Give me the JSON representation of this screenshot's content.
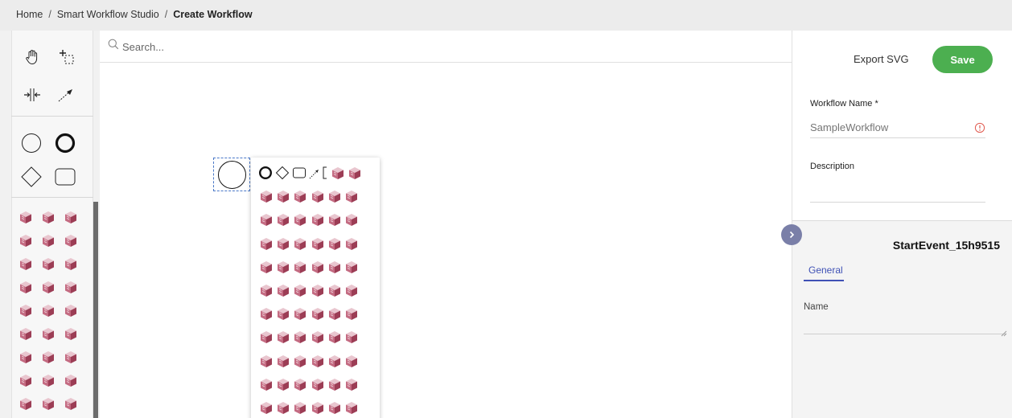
{
  "breadcrumb": {
    "items": [
      "Home",
      "Smart Workflow Studio"
    ],
    "separator": "/",
    "current": "Create Workflow"
  },
  "palette": {
    "tools": [
      "hand-tool-icon",
      "lasso-tool-icon",
      "space-tool-icon",
      "global-connect-icon"
    ],
    "shapes": [
      "start-event-icon",
      "end-event-icon",
      "gateway-icon",
      "task-icon"
    ],
    "custom_task_icon": "cube-task-icon"
  },
  "canvas": {
    "search": {
      "placeholder": "Search...",
      "value": ""
    },
    "selected_element": "start-event"
  },
  "context_pad": {
    "items": [
      "end-event-icon",
      "gateway-icon",
      "task-icon",
      "connect-icon",
      "annotation-icon",
      "cube-task-icon"
    ]
  },
  "panel": {
    "export_label": "Export SVG",
    "save_label": "Save",
    "workflow_name_label": "Workflow Name *",
    "workflow_name_placeholder": "SampleWorkflow",
    "description_label": "Description",
    "element_title": "StartEvent_15h9515",
    "tab_general": "General",
    "name_label": "Name"
  },
  "colors": {
    "save": "#4caf50",
    "accent": "#3f51b5",
    "cube_top": "#e9c6cf",
    "cube_left": "#c46b82",
    "cube_right": "#9c3d55",
    "error_icon": "#e05a4f",
    "expand_button": "#7a7fa8"
  }
}
